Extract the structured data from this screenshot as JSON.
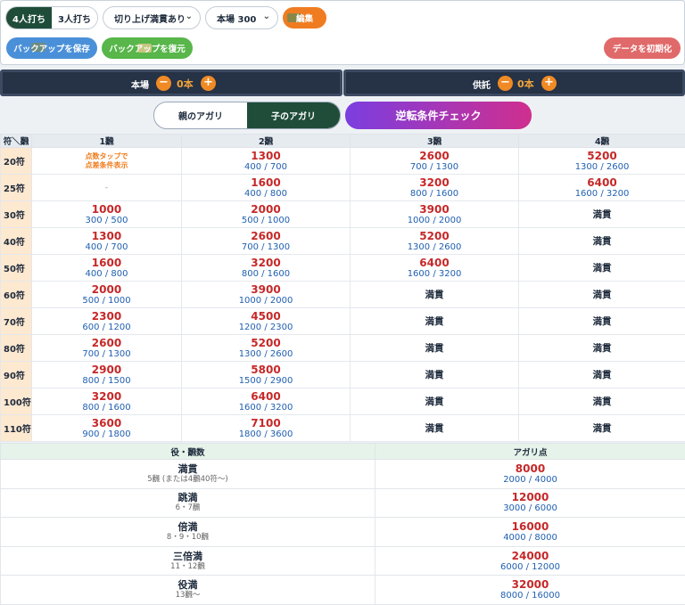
{
  "controls": {
    "seg_4p": "4人打ち",
    "seg_3p": "3人打ち",
    "rounding": "切り上げ満貫あり",
    "honba_select": "本場 300",
    "edit_button": "編集",
    "backup_save": "バックアップを保存",
    "backup_restore": "バックアップを復元",
    "reset": "データを初期化"
  },
  "counters": {
    "honba_label": "本場",
    "honba_value": "0本",
    "kyotaku_label": "供託",
    "kyotaku_value": "0本",
    "minus": "−",
    "plus": "+"
  },
  "tabs": {
    "oya": "親のアガリ",
    "ko": "子のアガリ",
    "reversal": "逆転条件チェック"
  },
  "fu_table": {
    "corner": "符＼飜",
    "han_headers": [
      "1飜",
      "2飜",
      "3飜",
      "4飜"
    ],
    "note_line1": "点数タップで",
    "note_line2": "点差条件表示",
    "dash": "-",
    "rows": [
      {
        "fu": "20符",
        "cells": [
          {
            "note": true
          },
          {
            "p": "1300",
            "s": "400 / 700"
          },
          {
            "p": "2600",
            "s": "700 / 1300"
          },
          {
            "p": "5200",
            "s": "1300 / 2600"
          }
        ]
      },
      {
        "fu": "25符",
        "cells": [
          {
            "dash": true
          },
          {
            "p": "1600",
            "s": "400 / 800"
          },
          {
            "p": "3200",
            "s": "800 / 1600"
          },
          {
            "p": "6400",
            "s": "1600 / 3200"
          }
        ]
      },
      {
        "fu": "30符",
        "cells": [
          {
            "p": "1000",
            "s": "300 / 500"
          },
          {
            "p": "2000",
            "s": "500 / 1000"
          },
          {
            "p": "3900",
            "s": "1000 / 2000"
          },
          {
            "m": "満貫"
          }
        ]
      },
      {
        "fu": "40符",
        "cells": [
          {
            "p": "1300",
            "s": "400 / 700"
          },
          {
            "p": "2600",
            "s": "700 / 1300"
          },
          {
            "p": "5200",
            "s": "1300 / 2600"
          },
          {
            "m": "満貫"
          }
        ]
      },
      {
        "fu": "50符",
        "cells": [
          {
            "p": "1600",
            "s": "400 / 800"
          },
          {
            "p": "3200",
            "s": "800 / 1600"
          },
          {
            "p": "6400",
            "s": "1600 / 3200"
          },
          {
            "m": "満貫"
          }
        ]
      },
      {
        "fu": "60符",
        "cells": [
          {
            "p": "2000",
            "s": "500 / 1000"
          },
          {
            "p": "3900",
            "s": "1000 / 2000"
          },
          {
            "m": "満貫"
          },
          {
            "m": "満貫"
          }
        ]
      },
      {
        "fu": "70符",
        "cells": [
          {
            "p": "2300",
            "s": "600 / 1200"
          },
          {
            "p": "4500",
            "s": "1200 / 2300"
          },
          {
            "m": "満貫"
          },
          {
            "m": "満貫"
          }
        ]
      },
      {
        "fu": "80符",
        "cells": [
          {
            "p": "2600",
            "s": "700 / 1300"
          },
          {
            "p": "5200",
            "s": "1300 / 2600"
          },
          {
            "m": "満貫"
          },
          {
            "m": "満貫"
          }
        ]
      },
      {
        "fu": "90符",
        "cells": [
          {
            "p": "2900",
            "s": "800 / 1500"
          },
          {
            "p": "5800",
            "s": "1500 / 2900"
          },
          {
            "m": "満貫"
          },
          {
            "m": "満貫"
          }
        ]
      },
      {
        "fu": "100符",
        "cells": [
          {
            "p": "3200",
            "s": "800 / 1600"
          },
          {
            "p": "6400",
            "s": "1600 / 3200"
          },
          {
            "m": "満貫"
          },
          {
            "m": "満貫"
          }
        ]
      },
      {
        "fu": "110符",
        "cells": [
          {
            "p": "3600",
            "s": "900 / 1800"
          },
          {
            "p": "7100",
            "s": "1800 / 3600"
          },
          {
            "m": "満貫"
          },
          {
            "m": "満貫"
          }
        ]
      }
    ]
  },
  "yaku_table": {
    "header_yaku": "役・飜数",
    "header_points": "アガリ点",
    "rows": [
      {
        "name": "満貫",
        "desc": "5飜 (または4飜40符〜)",
        "p": "8000",
        "s": "2000 / 4000"
      },
      {
        "name": "跳満",
        "desc": "6・7飜",
        "p": "12000",
        "s": "3000 / 6000"
      },
      {
        "name": "倍満",
        "desc": "8・9・10飜",
        "p": "16000",
        "s": "4000 / 8000"
      },
      {
        "name": "三倍満",
        "desc": "11・12飜",
        "p": "24000",
        "s": "6000 / 12000"
      },
      {
        "name": "役満",
        "desc": "13飜〜",
        "p": "32000",
        "s": "8000 / 16000"
      }
    ]
  },
  "colors": {
    "accent_green": "#1f4d3a",
    "accent_orange": "#f08a24",
    "point_red": "#c62828",
    "sub_blue": "#1f5fb0"
  }
}
